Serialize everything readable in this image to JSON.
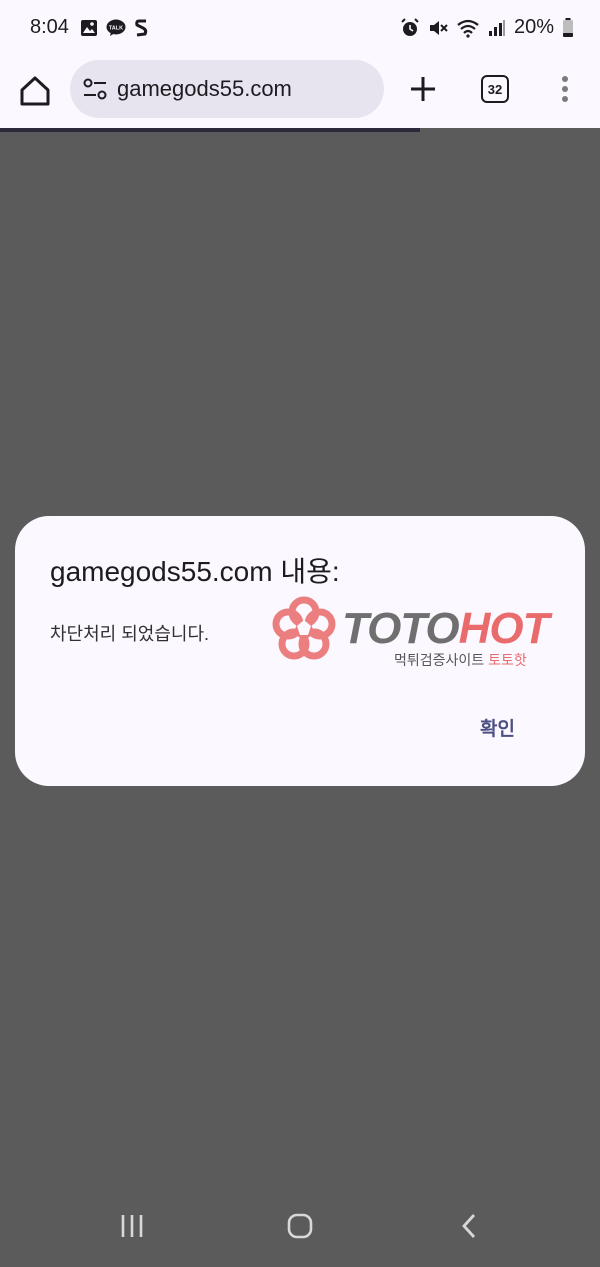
{
  "status_bar": {
    "time": "8:04",
    "battery": "20%",
    "icons_left": [
      "gallery-icon",
      "kakaotalk-icon",
      "s-app-icon"
    ],
    "icons_right": [
      "alarm-icon",
      "mute-icon",
      "wifi-icon",
      "signal-icon",
      "battery-icon"
    ]
  },
  "browser": {
    "url": "gamegods55.com",
    "tab_count": "32",
    "buttons": [
      "home-icon",
      "site-settings-icon",
      "new-tab-icon",
      "tab-switcher",
      "more-menu-icon"
    ]
  },
  "dialog": {
    "title": "gamegods55.com 내용:",
    "message": "차단처리 되었습니다.",
    "ok_label": "확인"
  },
  "watermark": {
    "brand_part1": "TOTO",
    "brand_part2": "HOT",
    "subtitle_prefix": "먹튀검증사이트 ",
    "subtitle_accent": "토토핫",
    "colors": {
      "accent": "#e96b6b",
      "grey": "#6f6f6f"
    }
  },
  "nav": [
    "recents-icon",
    "home-nav-icon",
    "back-icon"
  ]
}
